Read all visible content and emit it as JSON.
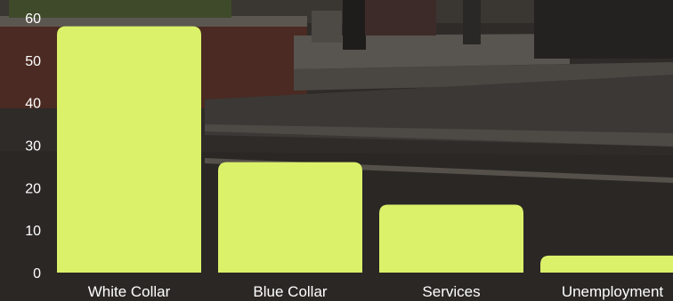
{
  "chart_data": {
    "type": "bar",
    "categories": [
      "White Collar",
      "Blue Collar",
      "Services",
      "Unemployment"
    ],
    "values": [
      58,
      26,
      16,
      4
    ],
    "ylim": [
      0,
      60
    ],
    "yticks": [
      0,
      10,
      20,
      30,
      40,
      50,
      60
    ],
    "grid": false,
    "bar_color": "#dcf16a",
    "text_color": "#ffffff"
  }
}
